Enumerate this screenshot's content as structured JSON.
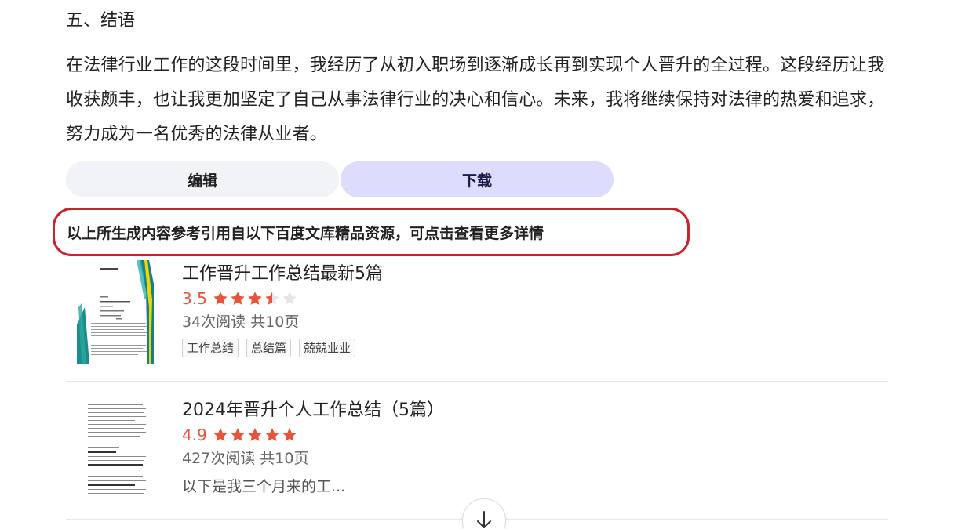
{
  "article": {
    "section_title": "五、结语",
    "paragraph": "在法律行业工作的这段时间里，我经历了从初入职场到逐渐成长再到实现个人晋升的全过程。这段经历让我收获颇丰，也让我更加坚定了自己从事法律行业的决心和信心。未来，我将继续保持对法律的热爱和追求，努力成为一名优秀的法律从业者。"
  },
  "actions": {
    "edit_label": "编辑",
    "download_label": "下载"
  },
  "reference_note": "以上所生成内容参考引用自以下百度文库精品资源，可点击查看更多详情",
  "documents": [
    {
      "title": "工作晋升工作总结最新5篇",
      "rating": "3.5",
      "rating_value": 3.5,
      "meta": "34次阅读 共10页",
      "tags": [
        "工作总结",
        "总结篇",
        "兢兢业业"
      ]
    },
    {
      "title": "2024年晋升个人工作总结（5篇）",
      "rating": "4.9",
      "rating_value": 4.9,
      "meta": "427次阅读 共10页",
      "snippet": "以下是我三个月来的工..."
    }
  ],
  "colors": {
    "rating": "#e8543a",
    "star_filled": "#e8543a",
    "star_empty": "#e6e6e6",
    "highlight_border": "#c9232b",
    "download_bg": "#dedcfd",
    "edit_bg": "#f2f3f7"
  },
  "icons": {
    "star": "star-icon",
    "scroll": "arrow-down-icon"
  }
}
